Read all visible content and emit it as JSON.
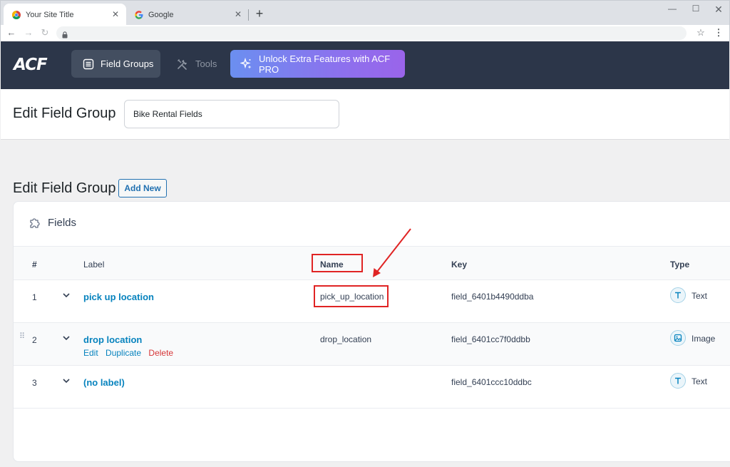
{
  "browser": {
    "tabs": [
      {
        "title": "Your Site Title",
        "active": true
      },
      {
        "title": "Google",
        "active": false
      }
    ]
  },
  "acf": {
    "logo": "ACF",
    "nav": {
      "field_groups": "Field Groups",
      "tools": "Tools",
      "pro": "Unlock Extra Features with ACF PRO"
    }
  },
  "header": {
    "title": "Edit Field Group",
    "group_title_value": "Bike Rental Fields"
  },
  "section": {
    "title": "Edit Field Group",
    "add_new": "Add New"
  },
  "fields_panel": {
    "title": "Fields",
    "columns": {
      "num": "#",
      "label": "Label",
      "name": "Name",
      "key": "Key",
      "type": "Type"
    },
    "rows": [
      {
        "num": "1",
        "label": "pick up location",
        "name": "pick_up_location",
        "key": "field_6401b4490ddba",
        "type": "Text",
        "type_icon": "text-icon"
      },
      {
        "num": "2",
        "label": "drop location",
        "name": "drop_location",
        "key": "field_6401cc7f0ddbb",
        "type": "Image",
        "type_icon": "image-icon",
        "actions": {
          "edit": "Edit",
          "duplicate": "Duplicate",
          "delete": "Delete"
        }
      },
      {
        "num": "3",
        "label": "(no label)",
        "name": "",
        "key": "field_6401ccc10ddbc",
        "type": "Text",
        "type_icon": "text-icon"
      }
    ]
  },
  "colors": {
    "acf_bar": "#2c3649",
    "link_blue": "#0783be",
    "delete_red": "#d63638",
    "annotation_red": "#e02424"
  }
}
